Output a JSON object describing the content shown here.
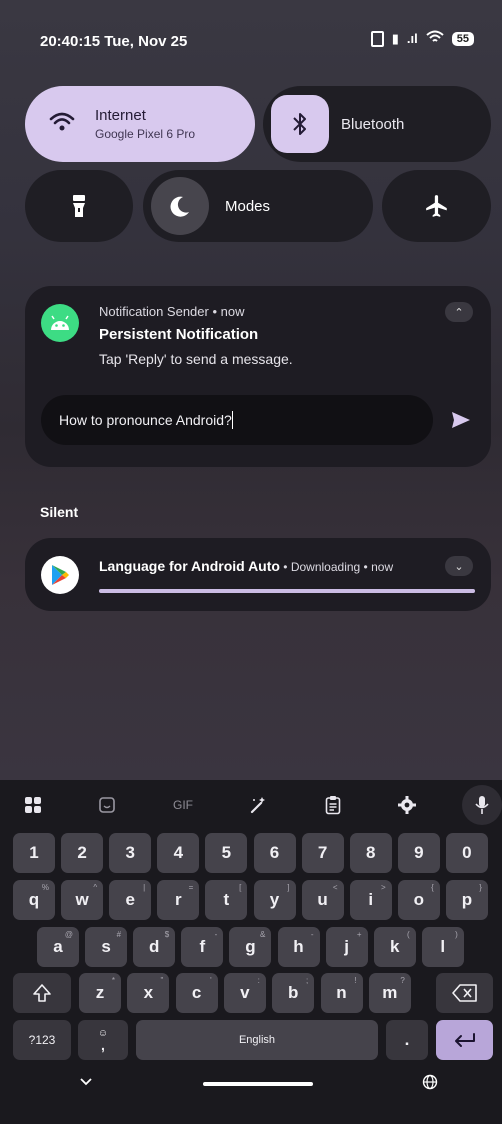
{
  "status": {
    "time": "20:40:15",
    "date": "Tue, Nov 25",
    "battery": "55"
  },
  "tiles": {
    "internet": {
      "label": "Internet",
      "sub": "Google Pixel 6 Pro"
    },
    "bluetooth": {
      "label": "Bluetooth"
    },
    "modes": {
      "label": "Modes"
    }
  },
  "notification": {
    "app": "Notification Sender",
    "time": "now",
    "title": "Persistent Notification",
    "text": "Tap 'Reply' to send a message.",
    "reply_value": "How to pronounce Android?"
  },
  "silent": {
    "header": "Silent",
    "title": "Language for Android Auto",
    "status": "Downloading",
    "time": "now",
    "progress": 1.0
  },
  "keyboard": {
    "gif_label": "GIF",
    "row_numbers": [
      "1",
      "2",
      "3",
      "4",
      "5",
      "6",
      "7",
      "8",
      "9",
      "0"
    ],
    "row1": [
      "q",
      "w",
      "e",
      "r",
      "t",
      "y",
      "u",
      "i",
      "o",
      "p"
    ],
    "row1_hints": [
      "%",
      "^",
      "|",
      "=",
      "[",
      "]",
      "<",
      ">",
      "{",
      "}"
    ],
    "row2": [
      "a",
      "s",
      "d",
      "f",
      "g",
      "h",
      "j",
      "k",
      "l"
    ],
    "row2_hints": [
      "@",
      "#",
      "$",
      "-",
      "&",
      "-",
      "+",
      "(",
      ")"
    ],
    "row3": [
      "z",
      "x",
      "c",
      "v",
      "b",
      "n",
      "m"
    ],
    "row3_hints": [
      "*",
      "\"",
      "'",
      ":",
      ";",
      "!",
      "?"
    ],
    "symbols_label": "?123",
    "space_label": "English",
    "period_label": ".",
    "comma_label": ","
  }
}
